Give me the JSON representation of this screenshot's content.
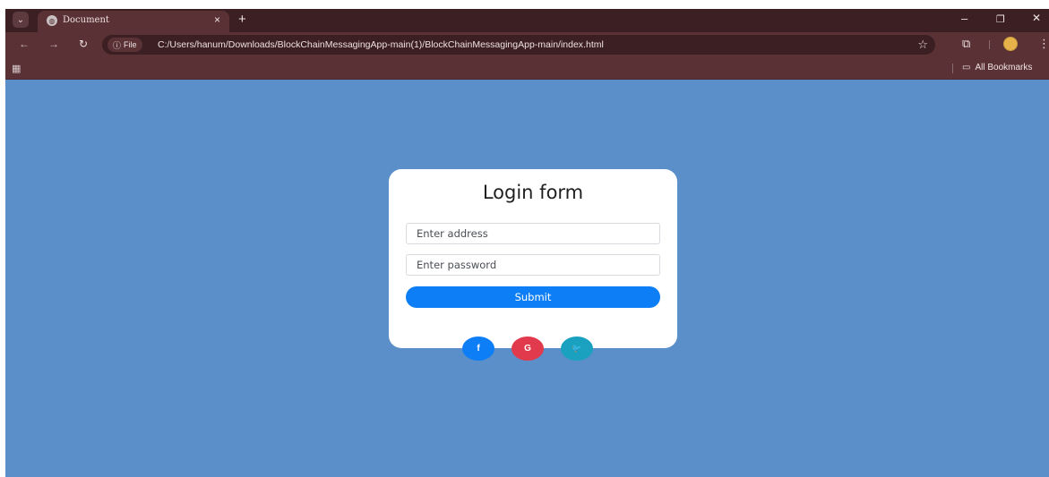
{
  "browser": {
    "tab_title": "Document",
    "tab_close": "×",
    "new_tab": "+",
    "url_chip_icon": "ⓘ",
    "url_chip_label": "File",
    "url": "C:/Users/hanum/Downloads/BlockChainMessagingApp-main(1)/BlockChainMessagingApp-main/index.html",
    "all_bookmarks": "All Bookmarks",
    "controls": {
      "minimize": "–",
      "restore": "❐",
      "close": "✕"
    },
    "icons": {
      "tab-search": "chevron-down-icon",
      "favicon": "globe-icon",
      "back": "arrow-left-icon",
      "forward": "arrow-right-icon",
      "reload": "reload-icon",
      "bookmark": "star-icon",
      "extensions": "puzzle-icon",
      "menu": "kebab-menu-icon",
      "apps": "apps-grid-icon",
      "folder": "folder-icon"
    }
  },
  "login": {
    "title": "Login form",
    "address_placeholder": "Enter address",
    "password_placeholder": "Enter password",
    "submit_label": "Submit"
  },
  "social": [
    {
      "label": "f",
      "icon": "facebook-icon",
      "color": "#0d7ef5"
    },
    {
      "label": "G",
      "icon": "google-icon",
      "color": "#e03a4c"
    },
    {
      "label": "🐦",
      "icon": "twitter-icon",
      "color": "#1aa1c0"
    }
  ],
  "colors": {
    "page_background": "#5b8fc9",
    "browser_frame": "#5a3236",
    "submit_button": "#0d7ef5"
  }
}
